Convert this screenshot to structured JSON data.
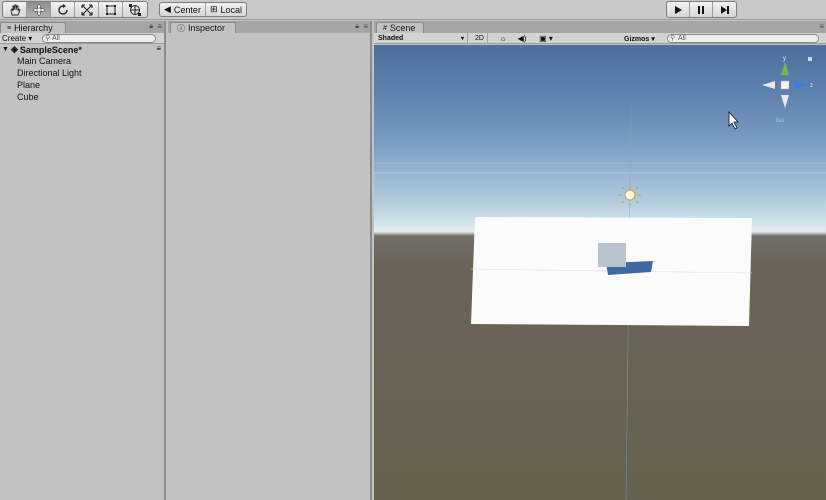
{
  "toolbar": {
    "tools": [
      {
        "name": "hand-tool",
        "icon": "hand-icon"
      },
      {
        "name": "move-tool",
        "icon": "move-arrows-icon"
      },
      {
        "name": "rotate-tool",
        "icon": "rotate-icon"
      },
      {
        "name": "scale-tool",
        "icon": "scale-icon"
      },
      {
        "name": "rect-tool",
        "icon": "rect-icon"
      },
      {
        "name": "transform-tool",
        "icon": "transform-icon"
      }
    ],
    "pivot_label": "Center",
    "space_label": "Local"
  },
  "hierarchy": {
    "tab_label": "Hierarchy",
    "create_label": "Create ▾",
    "search_placeholder": "All",
    "scene_name": "SampleScene*",
    "items": [
      "Main Camera",
      "Directional Light",
      "Plane",
      "Cube"
    ]
  },
  "inspector": {
    "tab_label": "Inspector"
  },
  "scene": {
    "tab_label": "Scene",
    "shading_mode": "Shaded",
    "mode_2d_label": "2D",
    "gizmos_label": "Gizmos ▾",
    "search_placeholder": "All",
    "orientation_label": "Iso",
    "axis_labels": {
      "y": "y",
      "z": "z"
    }
  },
  "colors": {
    "sky_top": "#4d6f9c",
    "horizon": "#e3edf0",
    "ground": "#67614f",
    "plane": "#ffffff",
    "cube": "#b8c3ce",
    "shadow": "#3e68a0",
    "gizmo_y": "#7ab84a",
    "gizmo_z": "#3a7be0"
  }
}
